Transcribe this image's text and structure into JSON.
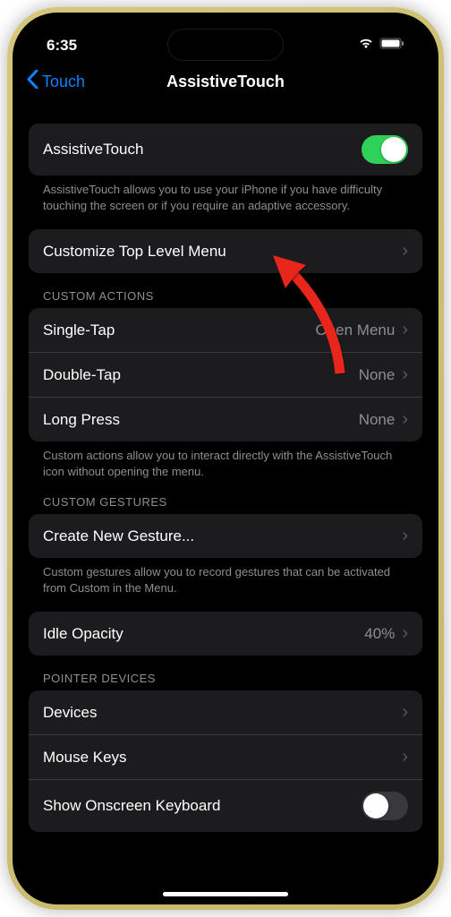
{
  "status": {
    "time": "6:35"
  },
  "nav": {
    "back_label": "Touch",
    "title": "AssistiveTouch"
  },
  "main_toggle": {
    "label": "AssistiveTouch",
    "enabled": true,
    "footer": "AssistiveTouch allows you to use your iPhone if you have difficulty touching the screen or if you require an adaptive accessory."
  },
  "customize": {
    "label": "Customize Top Level Menu"
  },
  "custom_actions": {
    "header": "CUSTOM ACTIONS",
    "items": [
      {
        "label": "Single-Tap",
        "value": "Open Menu"
      },
      {
        "label": "Double-Tap",
        "value": "None"
      },
      {
        "label": "Long Press",
        "value": "None"
      }
    ],
    "footer": "Custom actions allow you to interact directly with the AssistiveTouch icon without opening the menu."
  },
  "custom_gestures": {
    "header": "CUSTOM GESTURES",
    "label": "Create New Gesture...",
    "footer": "Custom gestures allow you to record gestures that can be activated from Custom in the Menu."
  },
  "idle_opacity": {
    "label": "Idle Opacity",
    "value": "40%"
  },
  "pointer_devices": {
    "header": "POINTER DEVICES",
    "items": [
      {
        "label": "Devices"
      },
      {
        "label": "Mouse Keys"
      },
      {
        "label": "Show Onscreen Keyboard"
      }
    ]
  }
}
